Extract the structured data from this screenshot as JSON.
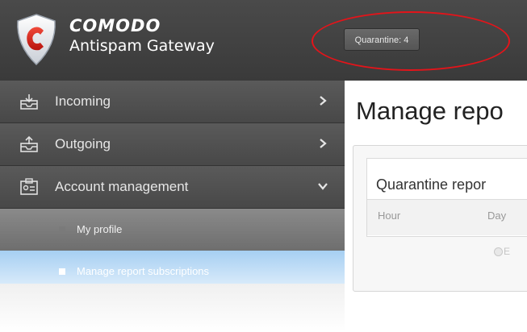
{
  "brand": {
    "name": "COMODO",
    "product": "Antispam Gateway"
  },
  "header": {
    "quarantine_label": "Quarantine: 4"
  },
  "sidebar": {
    "items": [
      {
        "label": "Incoming",
        "icon": "inbox-in-icon",
        "chevron": "chevron-right-icon"
      },
      {
        "label": "Outgoing",
        "icon": "inbox-out-icon",
        "chevron": "chevron-right-icon"
      },
      {
        "label": "Account management",
        "icon": "account-card-icon",
        "chevron": "chevron-down-icon"
      }
    ],
    "subitems": [
      {
        "label": "My profile"
      },
      {
        "label": "Manage report subscriptions",
        "active": true
      }
    ]
  },
  "main": {
    "title": "Manage repo",
    "panel_heading": "Quarantine repor",
    "columns": [
      "Hour",
      "Day"
    ],
    "radio_label": "E"
  },
  "colors": {
    "header_bg": "#3e3e3e",
    "sidebar_bg": "#505050",
    "active_item": "#a6cff2",
    "annotation": "#e3141a"
  }
}
